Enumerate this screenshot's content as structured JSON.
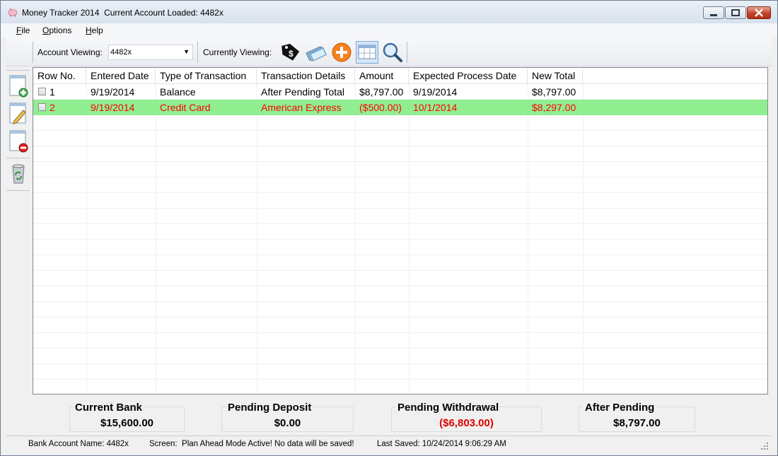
{
  "window": {
    "app_title": "Money Tracker 2014",
    "account_loaded_text": "Current Account Loaded: 4482x"
  },
  "menu": [
    {
      "label": "File",
      "accel": "F",
      "rest": "ile"
    },
    {
      "label": "Options",
      "accel": "O",
      "rest": "ptions"
    },
    {
      "label": "Help",
      "accel": "H",
      "rest": "elp"
    }
  ],
  "toolbar": {
    "account_viewing_label": "Account Viewing:",
    "account_selected": "4482x",
    "currently_viewing_label": "Currently Viewing:",
    "tools": [
      {
        "name": "tag-icon"
      },
      {
        "name": "checks-icon"
      },
      {
        "name": "add-circle-icon"
      },
      {
        "name": "calendar-view-icon",
        "active": true
      },
      {
        "name": "search-icon"
      }
    ]
  },
  "sidebar": [
    {
      "name": "add-row-icon"
    },
    {
      "name": "edit-row-icon"
    },
    {
      "name": "delete-row-icon"
    },
    {
      "name": "recycle-bin-icon"
    }
  ],
  "grid": {
    "columns": [
      "Row No.",
      "Entered Date",
      "Type of Transaction",
      "Transaction Details",
      "Amount",
      "Expected Process Date",
      "New Total"
    ],
    "rows": [
      {
        "row_no": "1",
        "entered": "9/19/2014",
        "type": "Balance",
        "details": "After Pending Total",
        "amount": "$8,797.00",
        "expected": "9/19/2014",
        "total": "$8,797.00",
        "highlight": false
      },
      {
        "row_no": "2",
        "entered": "9/19/2014",
        "type": "Credit Card",
        "details": "American Express",
        "amount": "($500.00)",
        "expected": "10/1/2014",
        "total": "$8,297.00",
        "highlight": true
      }
    ]
  },
  "summary": {
    "current_bank": {
      "label": "Current Bank",
      "value": "$15,600.00"
    },
    "pending_deposit": {
      "label": "Pending Deposit",
      "value": "$0.00"
    },
    "pending_withdrawal": {
      "label": "Pending Withdrawal",
      "value": "($6,803.00)"
    },
    "after_pending": {
      "label": "After Pending",
      "value": "$8,797.00"
    }
  },
  "status": {
    "bank_account": "Bank Account Name: 4482x",
    "screen": "Screen:  Plan Ahead Mode Active! No data will be saved!",
    "last_saved": "Last Saved: 10/24/2014 9:06:29 AM"
  },
  "colors": {
    "highlight_row_bg": "#90ee90",
    "highlight_row_text": "#ff0000",
    "negative_text": "#e00000"
  }
}
